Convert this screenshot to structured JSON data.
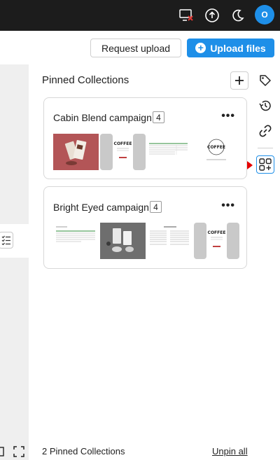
{
  "topbar": {
    "icons": [
      "screen-off-icon",
      "upload-cloud-icon",
      "moon-icon"
    ],
    "avatar_initial": "O"
  },
  "actions": {
    "request_upload_label": "Request upload",
    "upload_files_label": "Upload files"
  },
  "panel": {
    "title": "Pinned Collections",
    "add_icon": "plus-icon"
  },
  "rail": {
    "icons": [
      "tag-icon",
      "history-icon",
      "link-icon",
      "add-to-collection-icon"
    ],
    "active": "add-to-collection-icon"
  },
  "collections": [
    {
      "name": "Cabin Blend campaign",
      "count": "4",
      "thumbnails": [
        "coffee-bag-photo",
        "coffee-package-mockup",
        "spreadsheet-document",
        "coffee-logo-sheet"
      ]
    },
    {
      "name": "Bright Eyed campaign",
      "count": "4",
      "thumbnails": [
        "spreadsheet-document",
        "coffee-products-photo",
        "text-document",
        "coffee-package-mockup"
      ]
    }
  ],
  "footer": {
    "pinned_count_label": "2 Pinned Collections",
    "unpin_all_label": "Unpin all"
  },
  "colors": {
    "accent": "#1e8fe8",
    "topbar": "#1c1c1c",
    "pointer": "#e60000"
  }
}
